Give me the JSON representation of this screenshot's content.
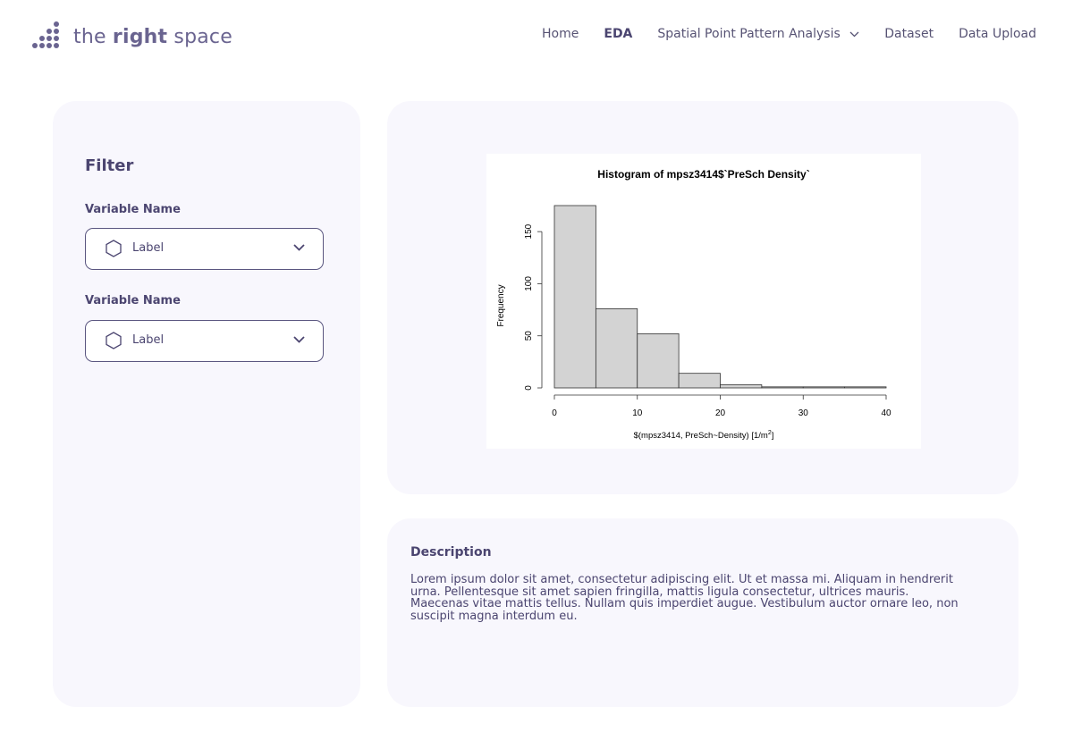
{
  "brand": {
    "prefix": "the ",
    "bold": "right",
    "suffix": " space"
  },
  "nav": {
    "items": [
      {
        "label": "Home"
      },
      {
        "label": "EDA"
      },
      {
        "label": "Spatial Point Pattern Analysis"
      },
      {
        "label": "Dataset"
      },
      {
        "label": "Data Upload"
      }
    ]
  },
  "filter": {
    "title": "Filter",
    "fields": [
      {
        "label": "Variable Name",
        "value": "Label"
      },
      {
        "label": "Variable Name",
        "value": "Label"
      }
    ]
  },
  "chart_data": {
    "type": "bar",
    "title": "Histogram of mpsz3414$`PreSch Density`",
    "xlabel": "$(mpsz3414, PreSch~Density) [1/m",
    "xlabel_sup": "2",
    "xlabel_end": "]",
    "ylabel": "Frequency",
    "bins": [
      [
        0,
        5
      ],
      [
        5,
        10
      ],
      [
        10,
        15
      ],
      [
        15,
        20
      ],
      [
        20,
        25
      ],
      [
        25,
        30
      ],
      [
        30,
        35
      ],
      [
        35,
        40
      ]
    ],
    "values": [
      175,
      76,
      52,
      14,
      3,
      1,
      1,
      1
    ],
    "xlim": [
      0,
      40
    ],
    "ylim": [
      0,
      175
    ],
    "xticks": [
      0,
      10,
      20,
      30,
      40
    ],
    "yticks": [
      0,
      50,
      100,
      150
    ],
    "bar_color": "#d3d3d3"
  },
  "description": {
    "title": "Description",
    "lines": [
      "Lorem ipsum dolor sit amet, consectetur adipiscing elit. Ut et massa mi. Aliquam in hendrerit",
      "urna. Pellentesque sit amet sapien fringilla, mattis ligula consectetur, ultrices mauris.",
      "Maecenas vitae mattis tellus. Nullam quis imperdiet augue. Vestibulum auctor ornare leo, non",
      "suscipit magna interdum eu."
    ]
  },
  "colors": {
    "accent": "#6a6490",
    "panel": "#f8f7fd",
    "border": "#5a5680"
  }
}
